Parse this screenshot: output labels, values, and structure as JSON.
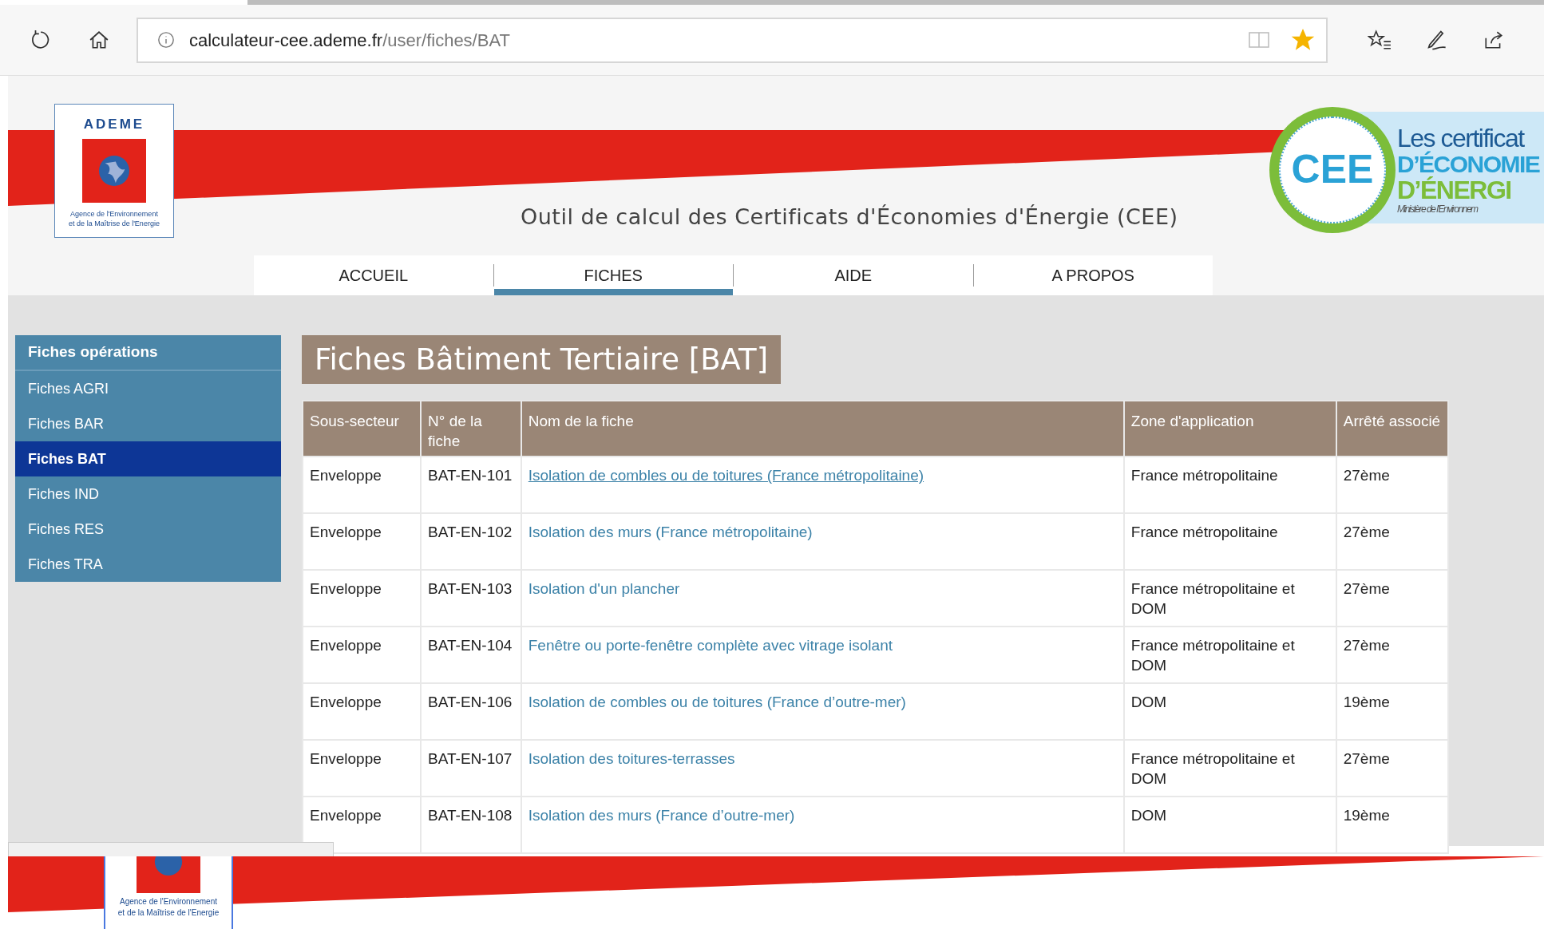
{
  "browser": {
    "url_host": "calculateur-cee.ademe.fr",
    "url_path": "/user/fiches/BAT",
    "favorited": true
  },
  "header": {
    "logo_name": "ADEME",
    "logo_caption": [
      "Agence de l'Environnement",
      "et de la Maîtrise de l'Energie"
    ],
    "title": "Outil de calcul des Certificats d'Économies d'Énergie (CEE)",
    "badge": "CEE",
    "badge_lines": [
      "Les certificat",
      "D’ÉCONOMIE",
      "D’ÉNERGI",
      "Ministère de l’Environnem"
    ]
  },
  "nav": [
    {
      "label": "ACCUEIL",
      "selected": false
    },
    {
      "label": "FICHES",
      "selected": true
    },
    {
      "label": "AIDE",
      "selected": false
    },
    {
      "label": "A PROPOS",
      "selected": false
    }
  ],
  "sidebar": {
    "title": "Fiches opérations",
    "items": [
      {
        "label": "Fiches AGRI",
        "selected": false
      },
      {
        "label": "Fiches BAR",
        "selected": false
      },
      {
        "label": "Fiches BAT",
        "selected": true
      },
      {
        "label": "Fiches IND",
        "selected": false
      },
      {
        "label": "Fiches RES",
        "selected": false
      },
      {
        "label": "Fiches TRA",
        "selected": false
      }
    ]
  },
  "page_title": "Fiches Bâtiment Tertiaire [BAT]",
  "table": {
    "columns": [
      "Sous-secteur",
      "N° de la fiche",
      "Nom de la fiche",
      "Zone d'application",
      "Arrêté associé"
    ],
    "rows": [
      {
        "cells": [
          "Enveloppe",
          "BAT-EN-101",
          "Isolation de combles ou de toitures (France métropolitaine)",
          "France métropolitaine",
          "27ème"
        ],
        "hovered": true
      },
      {
        "cells": [
          "Enveloppe",
          "BAT-EN-102",
          "Isolation des murs (France métropolitaine)",
          "France métropolitaine",
          "27ème"
        ],
        "hovered": false
      },
      {
        "cells": [
          "Enveloppe",
          "BAT-EN-103",
          "Isolation d'un plancher",
          "France métropolitaine et DOM",
          "27ème"
        ],
        "hovered": false
      },
      {
        "cells": [
          "Enveloppe",
          "BAT-EN-104",
          "Fenêtre ou porte-fenêtre complète avec vitrage isolant",
          "France métropolitaine et DOM",
          "27ème"
        ],
        "hovered": false
      },
      {
        "cells": [
          "Enveloppe",
          "BAT-EN-106",
          "Isolation de combles ou de toitures (France d’outre-mer)",
          "DOM",
          "19ème"
        ],
        "hovered": false
      },
      {
        "cells": [
          "Enveloppe",
          "BAT-EN-107",
          "Isolation des toitures-terrasses",
          "France métropolitaine et DOM",
          "27ème"
        ],
        "hovered": false
      },
      {
        "cells": [
          "Enveloppe",
          "BAT-EN-108",
          "Isolation des murs (France d’outre-mer)",
          "DOM",
          "19ème"
        ],
        "hovered": false
      }
    ]
  },
  "footer": {
    "logo_caption": [
      "Agence de l'Environnement",
      "et de la Maîtrise de l'Energie"
    ]
  }
}
